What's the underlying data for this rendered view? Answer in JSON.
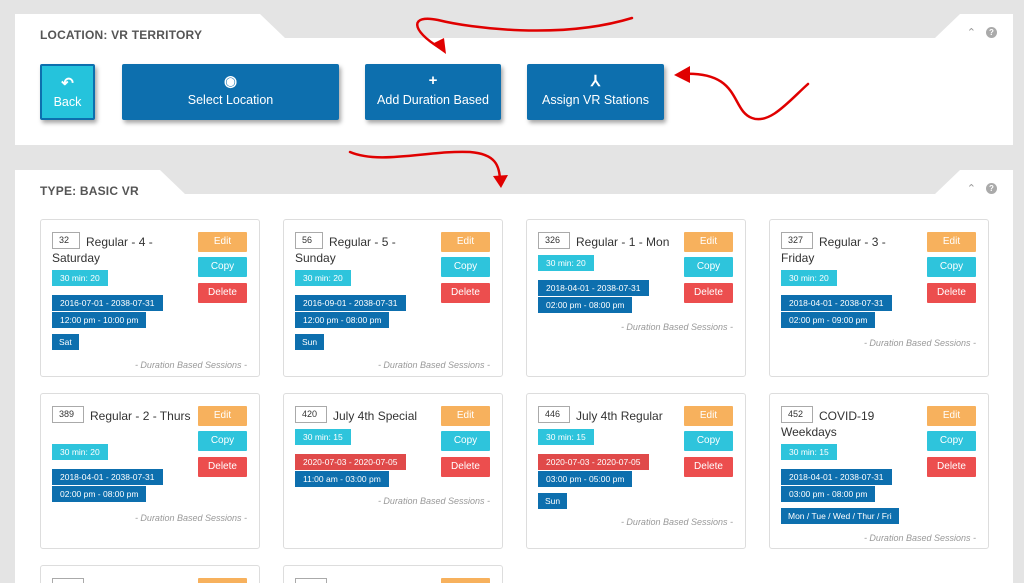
{
  "location_panel": {
    "title": "LOCATION: VR TERRITORY",
    "buttons": [
      {
        "label": "Back",
        "icon": "undo-arrow-icon",
        "glyph": "↶"
      },
      {
        "label": "Select Location",
        "icon": "globe-icon",
        "glyph": "◉"
      },
      {
        "label": "Add Duration Based",
        "icon": "plus-icon",
        "glyph": "+"
      },
      {
        "label": "Assign VR Stations",
        "icon": "sitemap-icon",
        "glyph": "⅄"
      }
    ]
  },
  "type_panel": {
    "title": "TYPE: BASIC VR",
    "actions": {
      "edit": "Edit",
      "copy": "Copy",
      "delete": "Delete"
    },
    "footer": "- Duration Based Sessions -",
    "cards": [
      {
        "num": "32",
        "title": "Regular - 4 - Saturday",
        "duration": "30 min: 20",
        "range": "2016-07-01 - 2038-07-31",
        "time": "12:00 pm - 10:00 pm",
        "days": "Sat"
      },
      {
        "num": "56",
        "title": "Regular - 5 - Sunday",
        "duration": "30 min: 20",
        "range": "2016-09-01 - 2038-07-31",
        "time": "12:00 pm - 08:00 pm",
        "days": "Sun"
      },
      {
        "num": "326",
        "title": "Regular - 1 - Mon",
        "duration": "30 min: 20",
        "range": "2018-04-01 - 2038-07-31",
        "time": "02:00 pm - 08:00 pm",
        "days": ""
      },
      {
        "num": "327",
        "title": "Regular - 3 - Friday",
        "duration": "30 min: 20",
        "range": "2018-04-01 - 2038-07-31",
        "time": "02:00 pm - 09:00 pm",
        "days": ""
      },
      {
        "num": "389",
        "title": "Regular - 2 - Thurs",
        "duration": "30 min: 20",
        "range": "2018-04-01 - 2038-07-31",
        "time": "02:00 pm - 08:00 pm",
        "days": ""
      },
      {
        "num": "420",
        "title": "July 4th Special",
        "duration": "30 min: 15",
        "range": "2020-07-03 - 2020-07-05",
        "time": "11:00 am - 03:00 pm",
        "days": ""
      },
      {
        "num": "446",
        "title": "July 4th Regular",
        "duration": "30 min: 15",
        "range": "2020-07-03 - 2020-07-05",
        "time": "03:00 pm - 05:00 pm",
        "days": "Sun"
      },
      {
        "num": "452",
        "title": "COVID-19 Weekdays",
        "duration": "30 min: 15",
        "range": "2018-04-01 - 2038-07-31",
        "time": "03:00 pm - 08:00 pm",
        "days": "Mon / Tue / Wed / Thur / Fri"
      }
    ]
  },
  "colors": {
    "primary": "#0d6fae",
    "cyan": "#2ec4dc",
    "edit": "#f7b15d",
    "delete": "#ec4e4e",
    "arrow": "#e00000"
  }
}
